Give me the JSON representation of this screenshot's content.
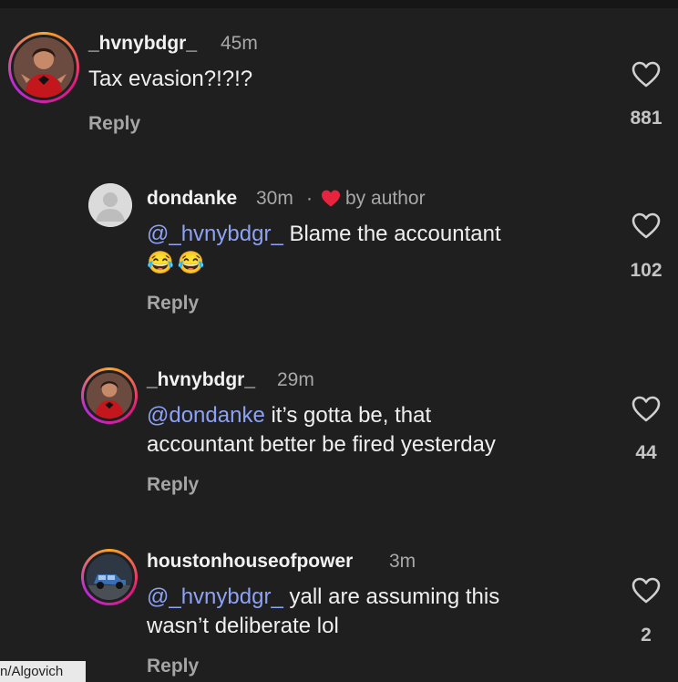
{
  "comments": [
    {
      "username": "_hvnybdgr_",
      "time": "45m",
      "text_lines": [
        "Tax evasion?!?!?"
      ],
      "reply_label": "Reply",
      "likes": "881",
      "avatar_icon": "kid-in-red-costume-avatar"
    },
    {
      "username": "dondanke",
      "time": "30m",
      "separator": "·",
      "author_badge": "by author",
      "mention": "@_hvnybdgr_",
      "text_after_mention": " Blame the accountant",
      "emoji_line": "😂😂",
      "reply_label": "Reply",
      "likes": "102",
      "avatar_icon": "default-user-avatar"
    },
    {
      "username": "_hvnybdgr_",
      "time": "29m",
      "mention": "@dondanke",
      "text_after_mention": " it’s gotta be, that",
      "second_line": "accountant better be fired yesterday",
      "reply_label": "Reply",
      "likes": "44",
      "avatar_icon": "kid-in-red-costume-avatar"
    },
    {
      "username": "houstonhouseofpower",
      "time": "3m",
      "mention": "@_hvnybdgr_",
      "text_after_mention": " yall are assuming this",
      "second_line": "wasn’t deliberate lol",
      "reply_label": "Reply",
      "likes": "2",
      "avatar_icon": "truck-avatar"
    }
  ],
  "watermark": "n/Algovich",
  "colors": {
    "background": "#1f1f1f",
    "mention": "#8da2f5",
    "heart_badge": "#e8233d",
    "story_ring": "#e5177e"
  }
}
